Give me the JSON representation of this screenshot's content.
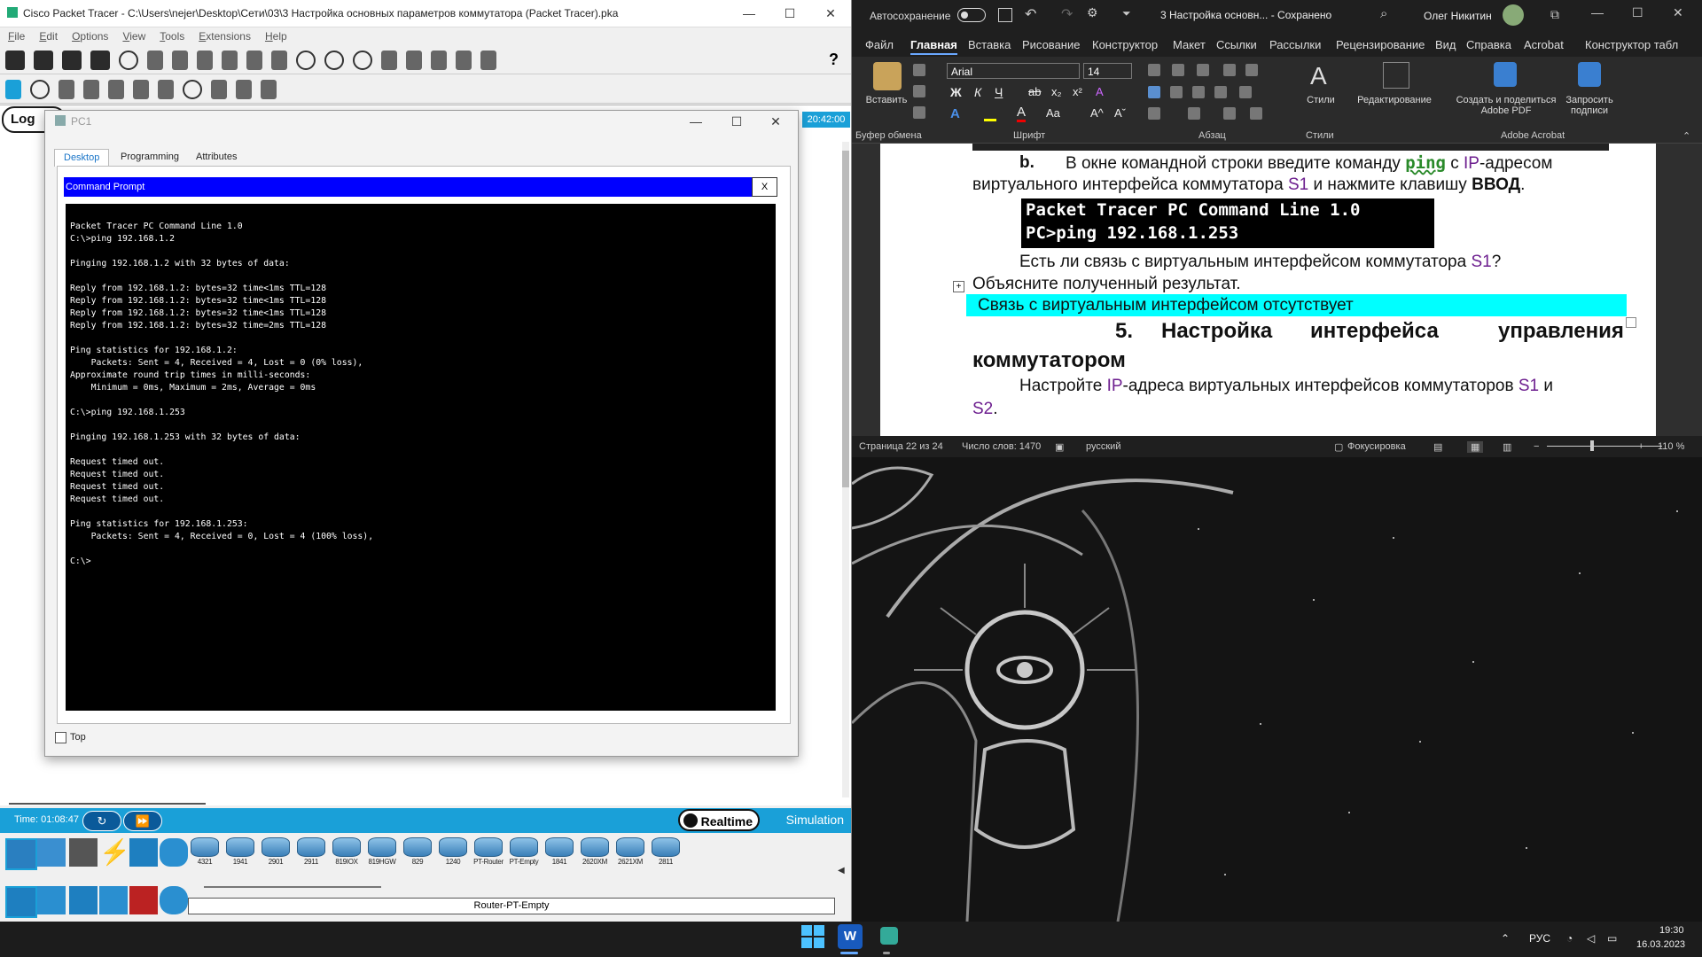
{
  "pt": {
    "title": "Cisco Packet Tracer - C:\\Users\\nejer\\Desktop\\Сети\\03\\3 Настройка основных параметров коммутатора (Packet Tracer).pka",
    "menu": [
      "File",
      "Edit",
      "Options",
      "View",
      "Tools",
      "Extensions",
      "Help"
    ],
    "logical_tab": "Log",
    "clock": "20:42:00",
    "time_label": "Time: 01:08:47",
    "realtime_label": "Realtime",
    "simulation_label": "Simulation",
    "devices": [
      "4321",
      "1941",
      "2901",
      "2911",
      "819IOX",
      "819HGW",
      "829",
      "1240",
      "PT-Router",
      "PT-Empty",
      "1841",
      "2620XM",
      "2621XM",
      "2811"
    ],
    "device_caption": "Router-PT-Empty"
  },
  "pc1": {
    "title": "PC1",
    "tabs": [
      "Desktop",
      "Programming",
      "Attributes"
    ],
    "cmd_title": "Command Prompt",
    "cmd_close": "X",
    "top_label": "Top",
    "terminal_text": "Packet Tracer PC Command Line 1.0\nC:\\>ping 192.168.1.2\n\nPinging 192.168.1.2 with 32 bytes of data:\n\nReply from 192.168.1.2: bytes=32 time<1ms TTL=128\nReply from 192.168.1.2: bytes=32 time<1ms TTL=128\nReply from 192.168.1.2: bytes=32 time<1ms TTL=128\nReply from 192.168.1.2: bytes=32 time=2ms TTL=128\n\nPing statistics for 192.168.1.2:\n    Packets: Sent = 4, Received = 4, Lost = 0 (0% loss),\nApproximate round trip times in milli-seconds:\n    Minimum = 0ms, Maximum = 2ms, Average = 0ms\n\nC:\\>ping 192.168.1.253\n\nPinging 192.168.1.253 with 32 bytes of data:\n\nRequest timed out.\nRequest timed out.\nRequest timed out.\nRequest timed out.\n\nPing statistics for 192.168.1.253:\n    Packets: Sent = 4, Received = 0, Lost = 4 (100% loss),\n\nC:\\>"
  },
  "word": {
    "autosave": "Автосохранение",
    "doc_title": "3 Настройка основн... - Сохранено",
    "user": "Олег Никитин",
    "tabs": [
      "Файл",
      "Главная",
      "Вставка",
      "Рисование",
      "Конструктор",
      "Макет",
      "Ссылки",
      "Рассылки",
      "Рецензирование",
      "Вид",
      "Справка",
      "Acrobat",
      "Конструктор табл"
    ],
    "ribbon": {
      "paste": "Вставить",
      "font": "Arial",
      "size": "14",
      "styles": "Стили",
      "editing": "Редактирование",
      "create_share": "Создать и поделиться Adobe PDF",
      "request_sign": "Запросить подписи",
      "groups": [
        "Буфер обмена",
        "Шрифт",
        "Абзац",
        "Стили",
        "Adobe Acrobat"
      ]
    },
    "doc": {
      "b_marker": "b.",
      "b_text1a": "В окне командной строки введите команду",
      "ping": "ping",
      "b_text1b": "с",
      "ip": "IP",
      "b_text1c": "-адресом",
      "b_text2a": "виртуального интерфейса коммутатора",
      "s1": "S1",
      "b_text2b": "и нажмите клавишу",
      "vvod": "ВВОД",
      "code1": "Packet Tracer PC Command Line 1.0",
      "code2": "PC>ping 192.168.1.253",
      "question_a": "Есть ли связь с виртуальным интерфейсом коммутатора",
      "question_b": "?",
      "explain": "Объясните полученный результат.",
      "answer": "Связь с виртуальным интерфейсом отсутствует",
      "h5_num": "5.",
      "h5_a": "Настройка",
      "h5_b": "интерфейса",
      "h5_c": "управления",
      "h5_d": "коммутатором",
      "p_a": "Настройте",
      "p_b": "-адреса виртуальных интерфейсов коммутаторов",
      "p_c": "и",
      "s2": "S2",
      "p_d": "."
    },
    "status": {
      "page": "Страница 22 из 24",
      "words": "Число слов: 1470",
      "lang": "русский",
      "focus": "Фокусировка",
      "zoom": "110 %"
    }
  },
  "taskbar": {
    "lang": "РУС",
    "time": "19:30",
    "date": "16.03.2023"
  }
}
